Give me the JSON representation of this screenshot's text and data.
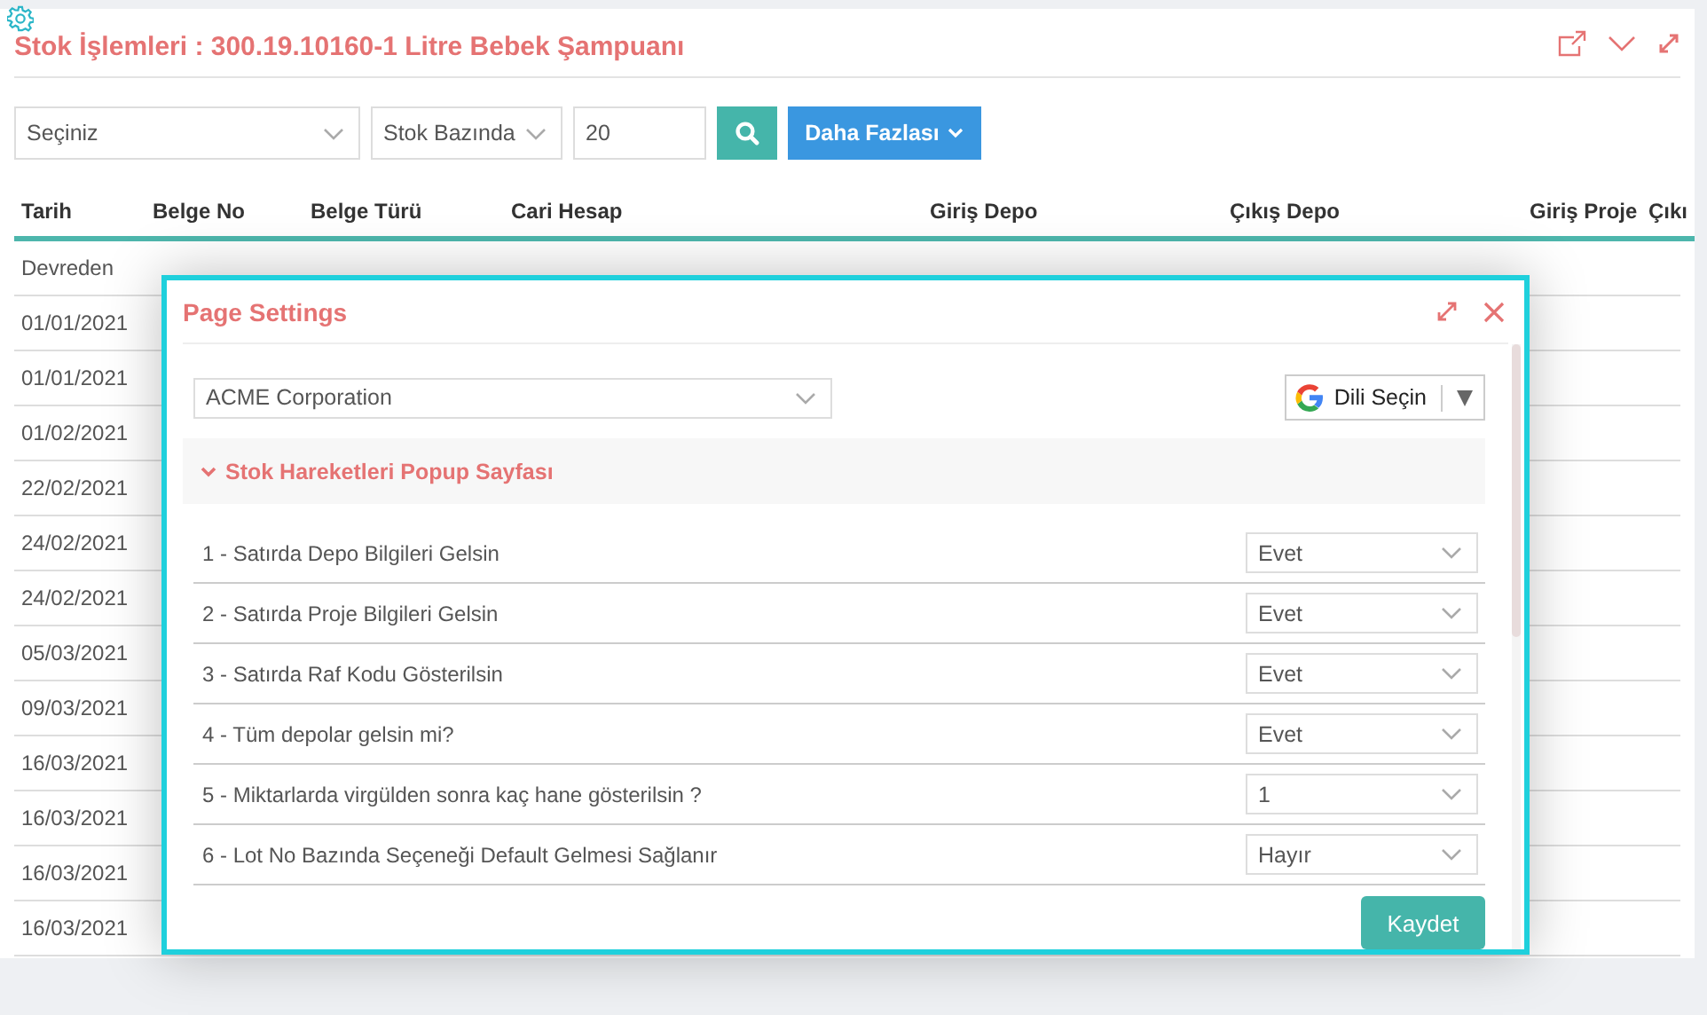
{
  "page": {
    "title": "Stok İşlemleri : 300.19.10160-1 Litre Bebek Şampuanı"
  },
  "filters": {
    "account": {
      "value": "Seçiniz"
    },
    "basis": {
      "value": "Stok Bazında"
    },
    "count": {
      "value": "20"
    },
    "more_button": "Daha Fazlası"
  },
  "table": {
    "columns": [
      "Tarih",
      "Belge No",
      "Belge Türü",
      "Cari Hesap",
      "Giriş Depo",
      "Çıkış Depo",
      "Giriş Proje",
      "Çıkı"
    ],
    "rows": [
      {
        "date": "Devreden"
      },
      {
        "date": "01/01/2021"
      },
      {
        "date": "01/01/2021"
      },
      {
        "date": "01/02/2021"
      },
      {
        "date": "22/02/2021"
      },
      {
        "date": "24/02/2021"
      },
      {
        "date": "24/02/2021"
      },
      {
        "date": "05/03/2021"
      },
      {
        "date": "09/03/2021"
      },
      {
        "date": "16/03/2021"
      },
      {
        "date": "16/03/2021"
      },
      {
        "date": "16/03/2021"
      },
      {
        "date": "16/03/2021"
      }
    ]
  },
  "dialog": {
    "title": "Page Settings",
    "company": {
      "value": "ACME Corporation"
    },
    "language": {
      "label": "Dili Seçin"
    },
    "section": {
      "title": "Stok Hareketleri Popup Sayfası",
      "expanded": true
    },
    "settings": [
      {
        "label": "1 - Satırda Depo Bilgileri Gelsin",
        "value": "Evet"
      },
      {
        "label": "2 - Satırda Proje Bilgileri Gelsin",
        "value": "Evet"
      },
      {
        "label": "3 - Satırda Raf Kodu Gösterilsin",
        "value": "Evet"
      },
      {
        "label": "4 - Tüm depolar gelsin mi?",
        "value": "Evet"
      },
      {
        "label": "5 - Miktarlarda virgülden sonra kaç hane gösterilsin ?",
        "value": "1"
      },
      {
        "label": "6 - Lot No Bazında Seçeneği Default Gelmesi Sağlanır",
        "value": "Hayır"
      }
    ],
    "save_button": "Kaydet"
  }
}
